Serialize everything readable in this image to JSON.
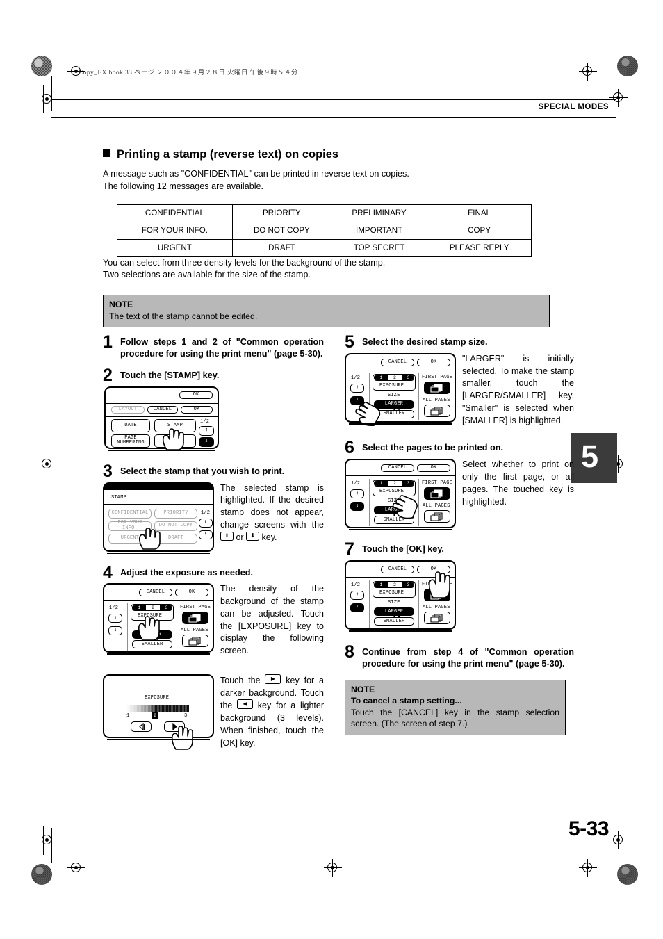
{
  "header": {
    "book_info": "Copy_EX.book   33 ページ   ２００４年９月２８日   火曜日   午後９時５４分",
    "running_head": "SPECIAL MODES",
    "chapter_tab": "5",
    "folio": "5-33"
  },
  "section": {
    "title": "Printing a stamp (reverse text) on copies",
    "intro_line1": "A message such as \"CONFIDENTIAL\" can be printed in reverse text on copies.",
    "intro_line2": "The following 12 messages are available.",
    "after_table_line1": "You can select from three density levels for the background of the stamp.",
    "after_table_line2": "Two selections are available for the size of the stamp."
  },
  "messages_table": {
    "rows": [
      [
        "CONFIDENTIAL",
        "PRIORITY",
        "PRELIMINARY",
        "FINAL"
      ],
      [
        "FOR YOUR INFO.",
        "DO NOT COPY",
        "IMPORTANT",
        "COPY"
      ],
      [
        "URGENT",
        "DRAFT",
        "TOP SECRET",
        "PLEASE REPLY"
      ]
    ]
  },
  "note_top": {
    "title": "NOTE",
    "body": "The text of the stamp cannot be edited."
  },
  "note_bottom": {
    "title": "NOTE",
    "subtitle": "To cancel a stamp setting...",
    "body": "Touch the [CANCEL] key in the stamp selection screen. (The screen of step 7.)"
  },
  "steps": {
    "s1": {
      "num": "1",
      "text": "Follow steps 1 and 2 of \"Common operation procedure for using the print menu\" (page 5-30)."
    },
    "s2": {
      "num": "2",
      "text": "Touch the [STAMP] key."
    },
    "s3": {
      "num": "3",
      "text": "Select the stamp that you wish to print.",
      "side_1": "The selected stamp is highlighted. If the desired stamp does not appear, change screens with the ",
      "side_2": " or ",
      "side_3": " key."
    },
    "s4": {
      "num": "4",
      "text": "Adjust the exposure as needed.",
      "side": "The density of the background of the stamp can be adjusted. Touch the [EXPOSURE] key to display the following screen.",
      "below_1": "Touch the ",
      "below_2": " key for a darker background. Touch the ",
      "below_3": " key for a lighter background (3 levels). When finished, touch the [OK] key."
    },
    "s5": {
      "num": "5",
      "text": "Select the desired stamp size.",
      "side": "\"LARGER\" is initially selected. To make the stamp smaller, touch the [LARGER/SMALLER] key. \"Smaller\" is selected when [SMALLER] is highlighted."
    },
    "s6": {
      "num": "6",
      "text": "Select the pages to be printed on.",
      "side": "Select whether to print on only the first page, or all pages. The touched key is highlighted."
    },
    "s7": {
      "num": "7",
      "text": "Touch the [OK] key."
    },
    "s8": {
      "num": "8",
      "text": "Continue from step 4 of \"Common operation procedure for using the print menu\" (page 5-30)."
    }
  },
  "panels": {
    "print_menu": {
      "ok_top": "OK",
      "layout": "LAYOUT",
      "cancel": "CANCEL",
      "ok": "OK",
      "date": "DATE",
      "stamp": "STAMP",
      "page_numbering": "PAGE\nNUMBERING",
      "page_indicator": "1/2",
      "up_arrow": "⬆",
      "down_arrow": "⬇"
    },
    "stamp_select": {
      "title": "STAMP",
      "page_indicator": "1/2",
      "keys": [
        "CONFIDENTIAL",
        "PRIORITY",
        "FOR YOUR INFO.",
        "DO NOT COPY",
        "URGENT",
        "DRAFT"
      ]
    },
    "stamp_settings": {
      "cancel": "CANCEL",
      "ok": "OK",
      "page_indicator": "1/2",
      "exposure_label": "EXPOSURE",
      "exposure_levels": [
        "1",
        "2",
        "3"
      ],
      "size_label": "SIZE",
      "larger": "LARGER",
      "smaller": "SMALLER",
      "first_page": "FIRST PAGE",
      "all_pages": "ALL PAGES"
    },
    "exposure_screen": {
      "title": "EXPOSURE",
      "tick_low": "1",
      "tick_current": "2",
      "tick_high": "3"
    }
  }
}
